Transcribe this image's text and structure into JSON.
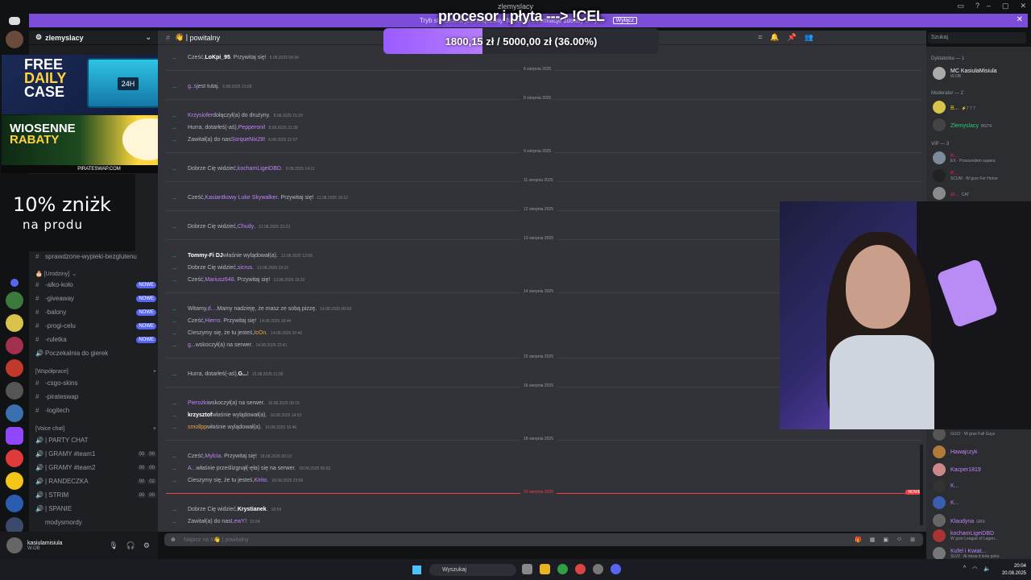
{
  "window": {
    "title": "zlemyslacy"
  },
  "banner": {
    "text": "Tryb streamera jest włączony. Niektóre informacje zostały ukryte.",
    "button": "Wyłącz"
  },
  "overlay": {
    "title": "procesor i płyta ---> !CEL"
  },
  "goal": {
    "current": "1800,15 zł",
    "target": "5000,00 zł",
    "label": "1800,15 zł / 5000,00 zł (36.00%)",
    "progress": 0.36
  },
  "guild": {
    "name": "zlemyslacy"
  },
  "channel": {
    "name": "powitalny",
    "search_placeholder": "Szukaj",
    "input_placeholder": "Napisz na #👋 | powitalny"
  },
  "ads": {
    "free_daily_case": {
      "line1": "FREE",
      "line2": "DAILY",
      "line3": "CASE",
      "box_label": "24H"
    },
    "wiosenne": {
      "line1": "WIOSENNE",
      "line2": "RABATY",
      "footer": "PIRATESWAP.COM"
    },
    "discount": {
      "line1": "10% zniżk",
      "line2": "na produ"
    }
  },
  "sidebar": {
    "partial_channel": "sprawdzone-wypieki-bezglutenu",
    "cat_urodziny": "[Urodziny]",
    "urodziny": [
      {
        "label": "-alko-koło",
        "badge": "NOWE"
      },
      {
        "label": "-giveaway",
        "badge": "NOWE"
      },
      {
        "label": "-balony",
        "badge": "NOWE"
      },
      {
        "label": "-progi-celu",
        "badge": "NOWE"
      },
      {
        "label": "-ruletka",
        "badge": "NOWE"
      },
      {
        "label": "Poczekalnia do gierek",
        "badge": ""
      }
    ],
    "cat_wspolpraca": "[Współprace]",
    "wspolpraca": [
      {
        "label": "-csgo-skins"
      },
      {
        "label": "-pirateswap"
      },
      {
        "label": "-logitech"
      }
    ],
    "cat_voice": "[Voice chat]",
    "voice": [
      {
        "label": "| PARTY CHAT",
        "c1": "",
        "c2": ""
      },
      {
        "label": "| GRAMY #team1",
        "c1": "00",
        "c2": "00"
      },
      {
        "label": "| GRAMY #team2",
        "c1": "00",
        "c2": "00"
      },
      {
        "label": "| RANDECZKA",
        "c1": "00",
        "c2": "02"
      },
      {
        "label": "| STRIM",
        "c1": "00",
        "c2": "00"
      },
      {
        "label": "| SPANIE",
        "c1": "",
        "c2": ""
      },
      {
        "label": "modysmordy",
        "c1": "",
        "c2": ""
      }
    ]
  },
  "user": {
    "name": "kasiulamisiula",
    "status": "W.OB"
  },
  "messages": [
    {
      "pre": "Cześć, ",
      "user": "LoKpi_95",
      "post": ". Przywitaj się!",
      "ts": "5.08.2025 04:34",
      "style": "w"
    },
    {
      "pre": "",
      "user": "g..s",
      "post": " jest tutaj.",
      "ts": "6.08.2025 21:09",
      "style": "u"
    },
    {
      "pre": "",
      "user": "Krzysiofer",
      "post": " dołączył(a) do drużyny.",
      "ts": "8.08.2025 21:29",
      "style": "u"
    },
    {
      "pre": "Hurra, dotarłeś(-aś), ",
      "user": "Pepperoni",
      "post": "!",
      "ts": "8.08.2025 21:39",
      "style": "u"
    },
    {
      "pre": "Zawitał(a) do nas ",
      "user": "SorqueNix28",
      "post": "!",
      "ts": "8.08.2025 22:07",
      "style": "u"
    },
    {
      "pre": "Dobrze Cię widzieć, ",
      "user": "kochamLigeiDBD",
      "post": ".",
      "ts": "9.08.2025 14:11",
      "style": "u"
    },
    {
      "pre": "Cześć, ",
      "user": "Kasiantkowy Luke Skywalker",
      "post": ". Przywitaj się!",
      "ts": "11.08.2025 16:12",
      "style": "u"
    },
    {
      "pre": "Dobrze Cię widzieć, ",
      "user": "Chudy",
      "post": ".",
      "ts": "12.08.2025 23:23",
      "style": "u"
    },
    {
      "pre": "",
      "user": "Tommy-Fi DJ",
      "post": " właśnie wylądował(a).",
      "ts": "13.08.2025 12:56",
      "style": "w"
    },
    {
      "pre": "Dobrze Cię widzieć, ",
      "user": "sicrus",
      "post": ".",
      "ts": "13.08.2025 19:22",
      "style": "u"
    },
    {
      "pre": "Cześć, ",
      "user": "Mariusz648",
      "post": ". Przywitaj się!",
      "ts": "13.08.2025 19:33",
      "style": "u"
    },
    {
      "pre": "Witamy, ",
      "user": "d....",
      "post": " Mamy nadzieję, że masz ze sobą pizzę.",
      "ts": "14.08.2025 00:09",
      "style": "u"
    },
    {
      "pre": "Cześć, ",
      "user": "Hierro",
      "post": ". Przywitaj się!",
      "ts": "14.08.2025 18:44",
      "style": "u"
    },
    {
      "pre": "Cieszymy się, że tu jesteś, ",
      "user": "IcOn",
      "post": ".",
      "ts": "14.08.2025 20:46",
      "style": "o"
    },
    {
      "pre": "",
      "user": "g...",
      "post": " wskoczył(a) na serwer.",
      "ts": "14.08.2025 22:41",
      "style": "u"
    },
    {
      "pre": "Hurra, dotarłeś(-aś), ",
      "user": "G...",
      "post": "!",
      "ts": "15.08.2025 11:39",
      "style": "w"
    },
    {
      "pre": "",
      "user": "Pierożki",
      "post": " wskoczył(a) na serwer.",
      "ts": "16.08.2025 09:19",
      "style": "u"
    },
    {
      "pre": "",
      "user": "krzysztof",
      "post": " właśnie wylądował(a).",
      "ts": "16.08.2025 14:53",
      "style": "w"
    },
    {
      "pre": "",
      "user": "smollpp",
      "post": " właśnie wylądował(a).",
      "ts": "16.08.2025 16:46",
      "style": "o"
    },
    {
      "pre": "Cześć, ",
      "user": "Mylcia",
      "post": ". Przywitaj się!",
      "ts": "18.08.2025 00:13",
      "style": "u"
    },
    {
      "pre": "",
      "user": "A...",
      "post": " właśnie prześlizgnął(-ęła) się na serwer.",
      "ts": "18.08.2025 09:53",
      "style": "u"
    },
    {
      "pre": "Cieszymy się, że tu jesteś, ",
      "user": "Kirito",
      "post": ".",
      "ts": "18.08.2025 23:56",
      "style": "u"
    },
    {
      "pre": "Dobrze Cię widzieć, ",
      "user": "Krystianek",
      "post": ".",
      "ts": "16:54",
      "style": "w"
    },
    {
      "pre": "Zawitał(a) do nas ",
      "user": "LewY",
      "post": "!",
      "ts": "16:54",
      "style": "u"
    }
  ],
  "dates": [
    "6 sierpnia 2025",
    "8 sierpnia 2025",
    "9 sierpnia 2025",
    "11 sierpnia 2025",
    "12 sierpnia 2025",
    "13 sierpnia 2025",
    "14 sierpnia 2025",
    "15 sierpnia 2025",
    "16 sierpnia 2025",
    "18 sierpnia 2025"
  ],
  "new_date": "20 sierpnia 2025",
  "new_badge": "NOWE",
  "members": {
    "cat1": "Dyktatorka — 1",
    "m1": {
      "name": "MC KasiulaMisiula",
      "status": "W.OB"
    },
    "cat2": "Moderator — 2",
    "m2": {
      "name": "B...",
      "status": "⚡7 7 7"
    },
    "m3": {
      "name": "Zlemyslacy",
      "status": "BGTK"
    },
    "cat3": "VIP — 3",
    "m4": {
      "name": "K...",
      "status": "EX · Przeszedem sapera"
    },
    "m5": {
      "name": "P...",
      "status": "SCUM · W grze For Honor"
    },
    "m6": {
      "name": "w...",
      "status": "CAT"
    },
    "m7": {
      "name": "",
      "status": "GUCI · W grze Fall Guys"
    },
    "m8": {
      "name": "Hawajczyk",
      "status": ""
    },
    "m9": {
      "name": "Kacper1819",
      "status": ""
    },
    "m10": {
      "name": "K...",
      "status": ""
    },
    "m11": {
      "name": "K...",
      "status": ""
    },
    "m12": {
      "name": "Klaudyna",
      "status": "GRX"
    },
    "m13": {
      "name": "kochamLigeiDBD",
      "status": "W grze League of Legen..."
    },
    "m14": {
      "name": "Kufel i Kwiat...",
      "status": "SLV2 · Al misia it lerie poko"
    }
  },
  "taskbar": {
    "search": "Wyszukaj",
    "time": "20:04",
    "date": "20.08.2025"
  }
}
